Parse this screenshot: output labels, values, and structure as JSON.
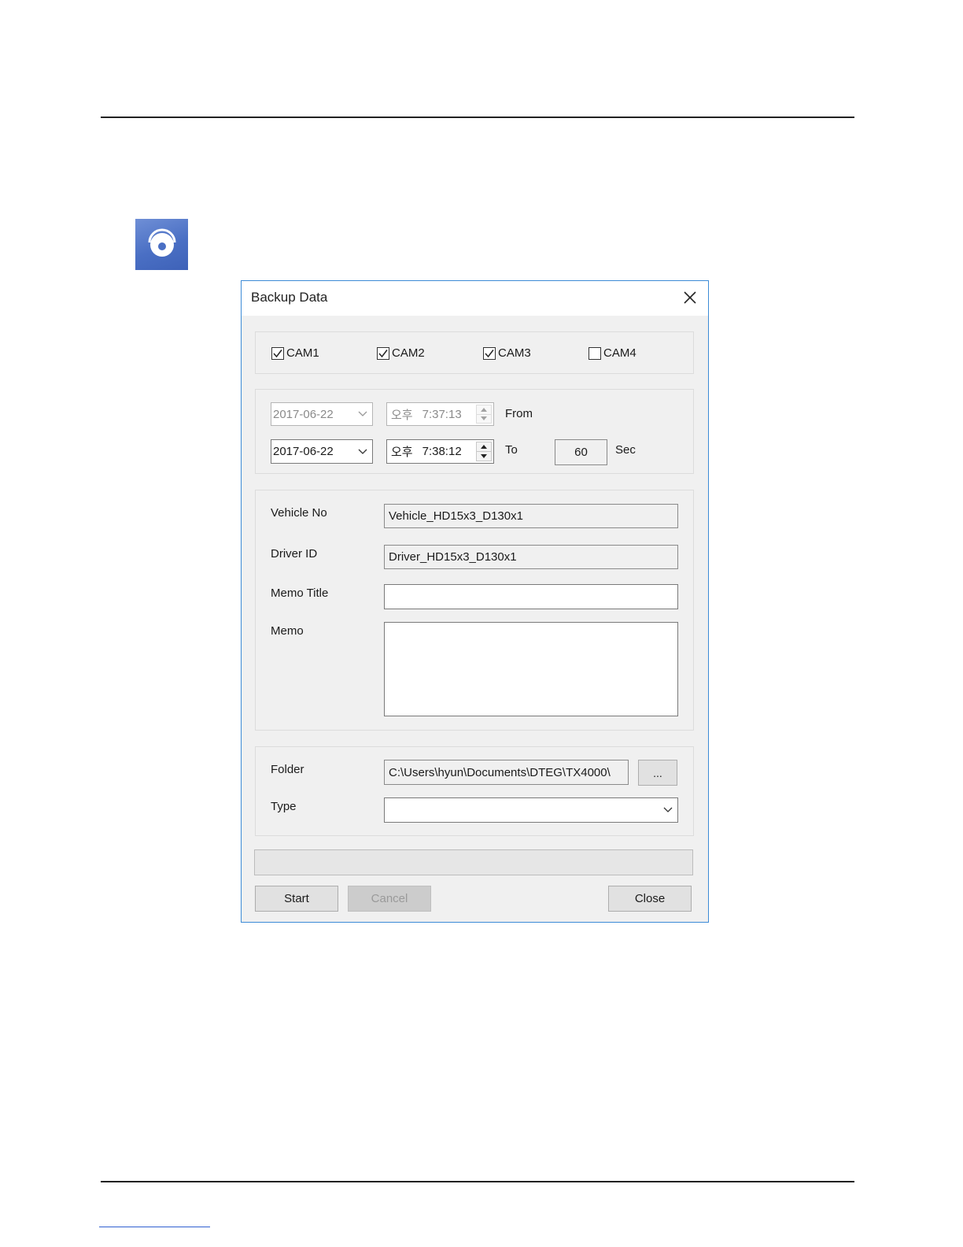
{
  "dialog": {
    "title": "Backup Data",
    "cameras": [
      {
        "label": "CAM1",
        "checked": true
      },
      {
        "label": "CAM2",
        "checked": true
      },
      {
        "label": "CAM3",
        "checked": true
      },
      {
        "label": "CAM4",
        "checked": false
      }
    ],
    "time_range": {
      "from_date": "2017-06-22",
      "from_ampm": "오후",
      "from_time": "7:37:13",
      "from_label": "From",
      "to_date": "2017-06-22",
      "to_ampm": "오후",
      "to_time": "7:38:12",
      "to_label": "To",
      "duration": "60",
      "duration_unit": "Sec"
    },
    "info": {
      "vehicle_label": "Vehicle No",
      "vehicle_value": "Vehicle_HD15x3_D130x1",
      "driver_label": "Driver ID",
      "driver_value": "Driver_HD15x3_D130x1",
      "memo_title_label": "Memo Title",
      "memo_title_value": "",
      "memo_label": "Memo",
      "memo_value": ""
    },
    "output": {
      "folder_label": "Folder",
      "folder_value": "C:\\Users\\hyun\\Documents\\DTEG\\TX4000\\",
      "browse_label": "...",
      "type_label": "Type",
      "type_value": ""
    },
    "progress": 0,
    "buttons": {
      "start": "Start",
      "cancel": "Cancel",
      "close": "Close"
    }
  }
}
